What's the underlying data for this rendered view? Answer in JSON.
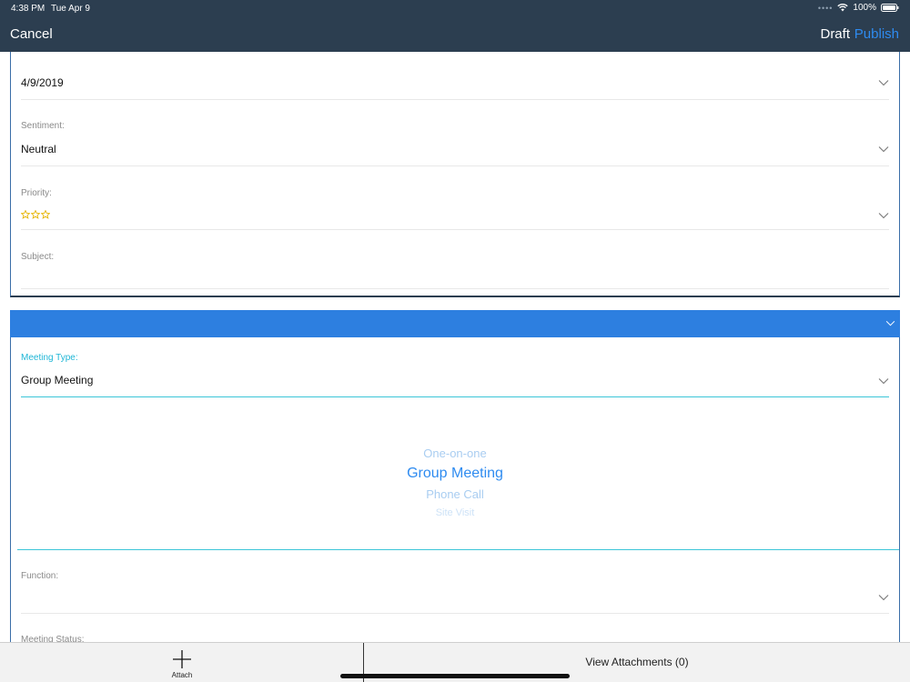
{
  "status_bar": {
    "time": "4:38 PM",
    "date": "Tue Apr 9",
    "battery": "100%"
  },
  "nav": {
    "cancel_label": "Cancel",
    "draft_label": "Draft",
    "publish_label": "Publish"
  },
  "form": {
    "date_value": "4/9/2019",
    "sentiment_label": "Sentiment:",
    "sentiment_value": "Neutral",
    "priority_label": "Priority:",
    "priority_stars": 3,
    "subject_label": "Subject:"
  },
  "meeting": {
    "type_label": "Meeting Type:",
    "type_value": "Group Meeting",
    "picker_options": [
      "One-on-one",
      "Group Meeting",
      "Phone Call",
      "Site Visit"
    ],
    "function_label": "Function:",
    "status_label": "Meeting Status:"
  },
  "toolbar": {
    "attach_label": "Attach",
    "view_attachments_label": "View Attachments (0)"
  },
  "colors": {
    "nav_bg": "#2c3e50",
    "accent": "#2e8bf0",
    "section_header": "#2d7fe0",
    "teal": "#3cc6d8",
    "star": "#e6b400"
  },
  "icons": {
    "chevron": "chevron-down-icon",
    "star": "star-outline-icon",
    "attach": "plus-icon",
    "wifi": "wifi-icon",
    "battery": "battery-icon"
  }
}
